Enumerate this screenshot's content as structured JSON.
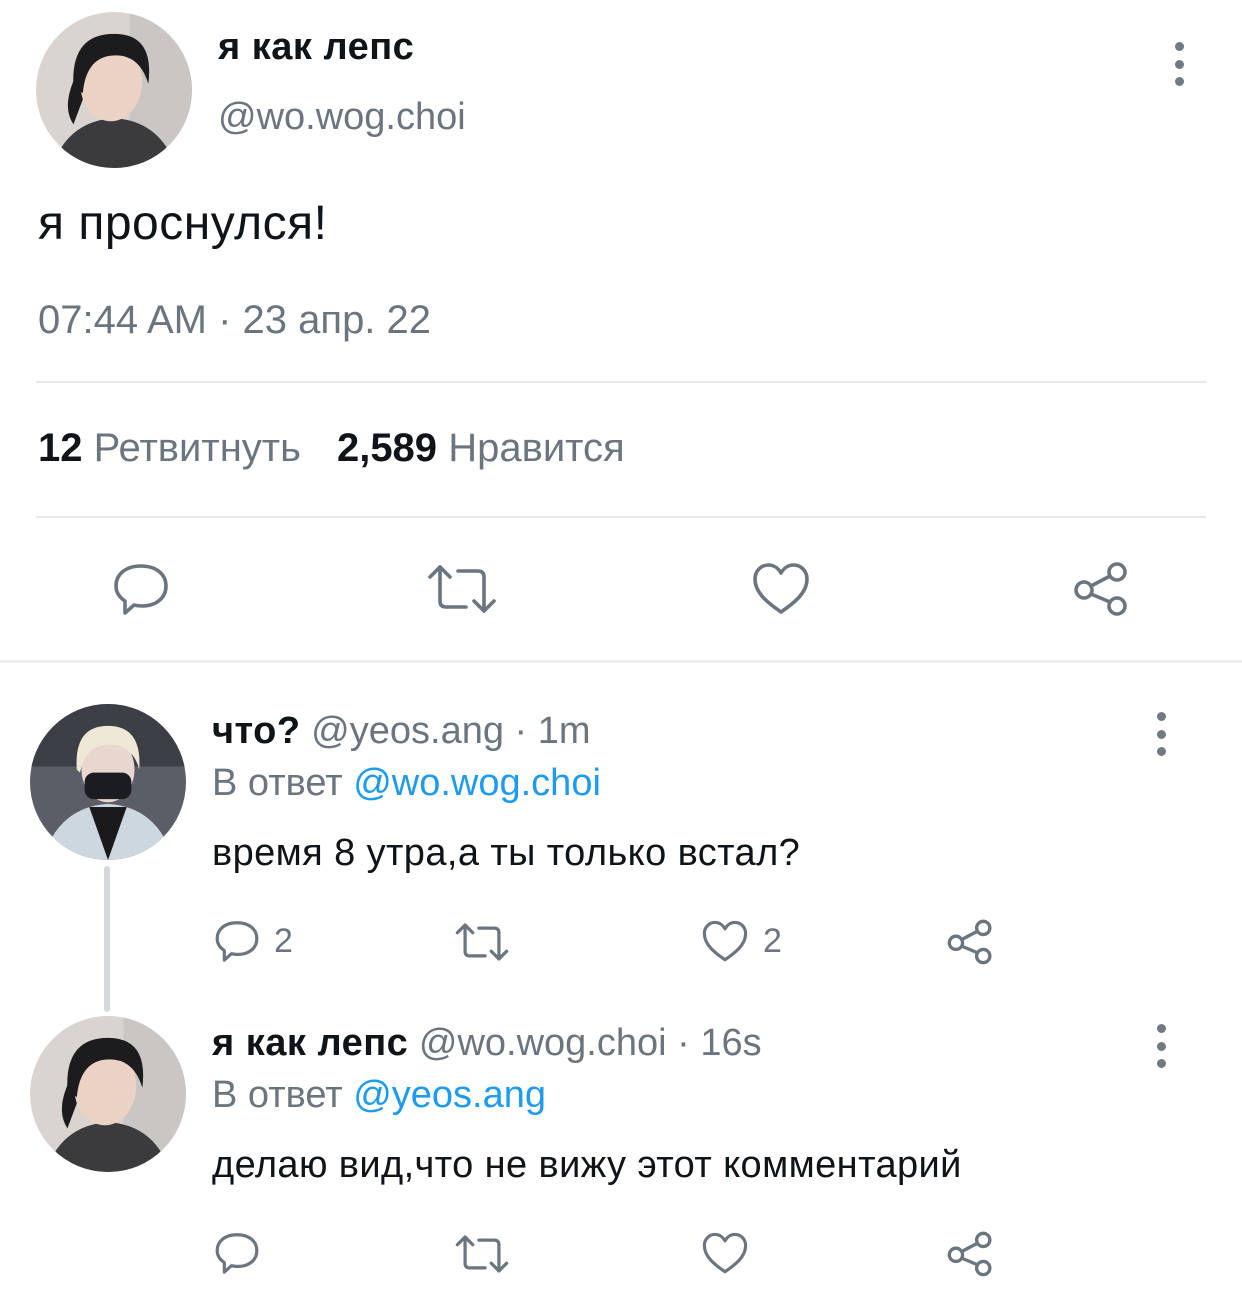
{
  "tweet": {
    "author_name": "я как лепс",
    "author_handle": "@wo.wog.choi",
    "text": "я проснулся!",
    "timestamp": "07:44 AM · 23 апр. 22",
    "retweets_count": "12",
    "retweets_label": "Ретвитнуть",
    "likes_count": "2,589",
    "likes_label": "Нравится"
  },
  "replies": [
    {
      "name": "что?",
      "meta": " @yeos.ang · 1m",
      "reply_prefix": "В ответ ",
      "reply_to": "@wo.wog.choi",
      "text": "время 8 утра,а ты только встал?",
      "reply_count": "2",
      "like_count": "2"
    },
    {
      "name": "я как лепс",
      "meta": " @wo.wog.choi · 16s",
      "reply_prefix": "В ответ ",
      "reply_to": "@yeos.ang",
      "text": "делаю вид,что не вижу этот комментарий",
      "reply_count": "",
      "like_count": ""
    }
  ],
  "icons": {
    "reply": "speech-bubble-icon",
    "retweet": "retweet-icon",
    "like": "heart-icon",
    "share": "share-icon",
    "more": "more-vertical-icon"
  },
  "colors": {
    "text_primary": "#0f1419",
    "text_secondary": "#6b7580",
    "mention": "#1d9bf0",
    "divider": "#e6e9ec"
  }
}
